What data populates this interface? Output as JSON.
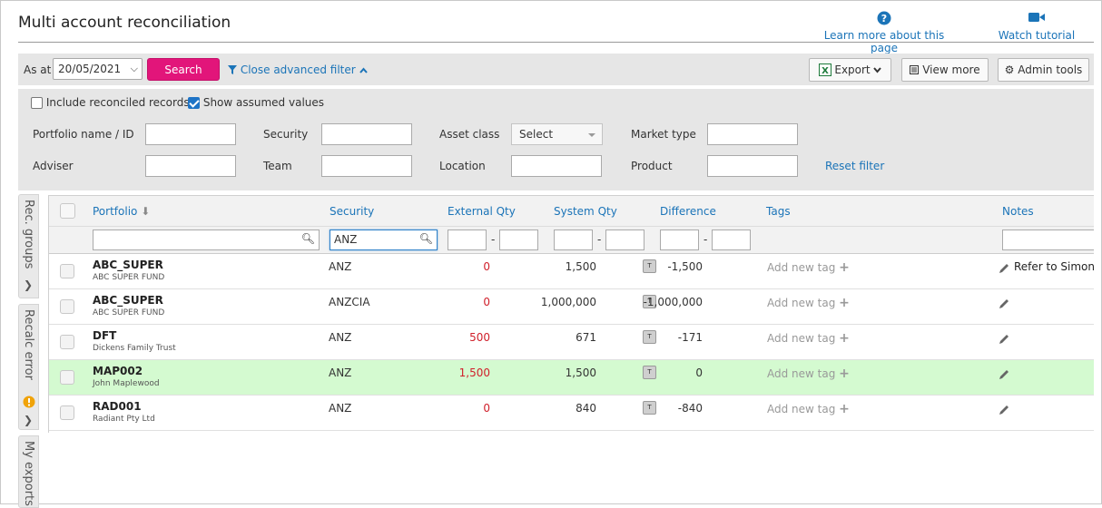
{
  "header": {
    "title": "Multi account reconciliation",
    "learn_more": "Learn more about this page",
    "watch_tutorial": "Watch tutorial"
  },
  "toolbar": {
    "as_at_label": "As at",
    "date_value": "20/05/2021",
    "search_label": "Search",
    "advanced_filter_label": "Close advanced filter",
    "export_label": "Export",
    "view_more_label": "View more",
    "admin_tools_label": "Admin tools"
  },
  "filters": {
    "include_reconciled": {
      "label": "Include reconciled records",
      "checked": false
    },
    "show_assumed": {
      "label": "Show assumed values",
      "checked": true
    },
    "portfolio_label": "Portfolio name / ID",
    "security_label": "Security",
    "asset_class_label": "Asset class",
    "asset_class_value": "Select",
    "market_type_label": "Market type",
    "adviser_label": "Adviser",
    "team_label": "Team",
    "location_label": "Location",
    "product_label": "Product",
    "reset_label": "Reset filter"
  },
  "side_tabs": {
    "rec_groups": "Rec. groups",
    "recalc_error": "Recalc error",
    "my_exports": "My exports"
  },
  "grid": {
    "columns": {
      "portfolio": "Portfolio",
      "security": "Security",
      "external_qty": "External Qty",
      "system_qty": "System Qty",
      "difference": "Difference",
      "tags": "Tags",
      "notes": "Notes"
    },
    "security_filter_value": "ANZ",
    "tag_label": "Add new tag",
    "rows": [
      {
        "code": "ABC_SUPER",
        "name": "ABC SUPER FUND",
        "security": "ANZ",
        "external_qty": "0",
        "system_qty": "1,500",
        "badge": "T",
        "difference": "-1,500",
        "note": "Refer to Simone",
        "highlight": false
      },
      {
        "code": "ABC_SUPER",
        "name": "ABC SUPER FUND",
        "security": "ANZCIA",
        "external_qty": "0",
        "system_qty": "1,000,000",
        "badge": "T",
        "difference": "-1,000,000",
        "note": "",
        "highlight": false
      },
      {
        "code": "DFT",
        "name": "Dickens Family Trust",
        "security": "ANZ",
        "external_qty": "500",
        "system_qty": "671",
        "badge": "T",
        "difference": "-171",
        "note": "",
        "highlight": false
      },
      {
        "code": "MAP002",
        "name": "John Maplewood",
        "security": "ANZ",
        "external_qty": "1,500",
        "system_qty": "1,500",
        "badge": "T",
        "difference": "0",
        "note": "",
        "highlight": true
      },
      {
        "code": "RAD001",
        "name": "Radiant Pty Ltd",
        "security": "ANZ",
        "external_qty": "0",
        "system_qty": "840",
        "badge": "T",
        "difference": "-840",
        "note": "",
        "highlight": false
      }
    ]
  },
  "colors": {
    "accent": "#e2157a",
    "link": "#1b74b8",
    "negative": "#d0202b",
    "highlight_row": "#d4fad0"
  }
}
